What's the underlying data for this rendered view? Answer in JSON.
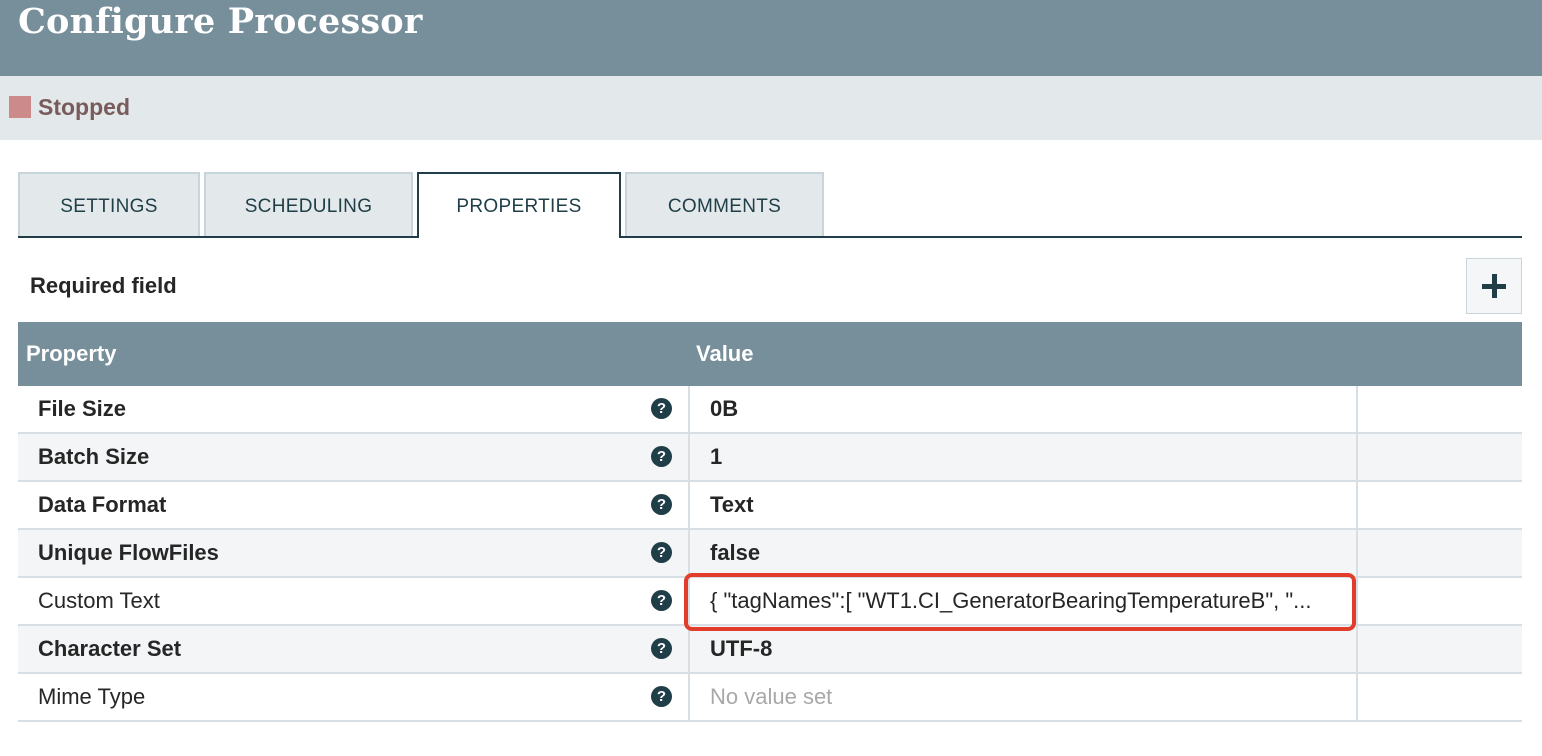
{
  "header": {
    "title": "Configure Processor"
  },
  "status": {
    "label": "Stopped",
    "color": "#cd8a8a"
  },
  "tabs": [
    {
      "label": "SETTINGS",
      "active": false
    },
    {
      "label": "SCHEDULING",
      "active": false
    },
    {
      "label": "PROPERTIES",
      "active": true
    },
    {
      "label": "COMMENTS",
      "active": false
    }
  ],
  "required_field_label": "Required field",
  "table": {
    "columns": [
      "Property",
      "Value"
    ],
    "rows": [
      {
        "name": "File Size",
        "value": "0B",
        "required": true
      },
      {
        "name": "Batch Size",
        "value": "1",
        "required": true
      },
      {
        "name": "Data Format",
        "value": "Text",
        "required": true
      },
      {
        "name": "Unique FlowFiles",
        "value": "false",
        "required": true
      },
      {
        "name": "Custom Text",
        "value": "{ \"tagNames\":[ \"WT1.CI_GeneratorBearingTemperatureB\", \"...",
        "required": false
      },
      {
        "name": "Character Set",
        "value": "UTF-8",
        "required": true
      },
      {
        "name": "Mime Type",
        "value": "No value set",
        "required": false
      }
    ]
  },
  "help_icon_glyph": "?",
  "icons": {
    "add": "plus-icon",
    "help": "help-icon"
  },
  "colors": {
    "header": "#778e9b",
    "accent": "#1f3e47",
    "highlight": "#e23d2a"
  }
}
